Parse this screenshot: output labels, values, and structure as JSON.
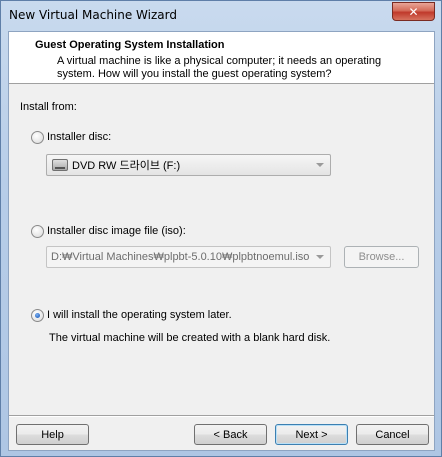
{
  "window": {
    "title": "New Virtual Machine Wizard",
    "close_symbol": "✕"
  },
  "header": {
    "title": "Guest Operating System Installation",
    "description_line1": "A virtual machine is like a physical computer; it needs an operating",
    "description_line2": "system. How will you install the guest operating system?"
  },
  "install_from": {
    "label": "Install from:",
    "installer_disc": {
      "label": "Installer disc:",
      "selected": false,
      "drive_value": "DVD RW 드라이브 (F:)"
    },
    "iso": {
      "label": "Installer disc image file (iso):",
      "selected": false,
      "path_value": "D:₩Virtual Machines₩plpbt-5.0.10₩plpbtnoemul.iso",
      "browse_label": "Browse..."
    },
    "later": {
      "label": "I will install the operating system later.",
      "selected": true,
      "note": "The virtual machine will be created with a blank hard disk."
    }
  },
  "footer": {
    "help": "Help",
    "back": "< Back",
    "next": "Next >",
    "cancel": "Cancel"
  }
}
